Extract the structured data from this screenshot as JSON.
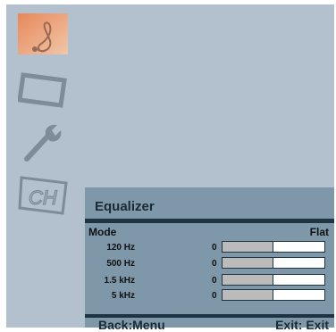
{
  "sidebar": {
    "items": [
      {
        "name": "audio",
        "icon": "music-note-icon",
        "selected": true
      },
      {
        "name": "picture",
        "icon": "tv-screen-icon",
        "selected": false
      },
      {
        "name": "setup",
        "icon": "wrench-icon",
        "selected": false
      },
      {
        "name": "channel",
        "icon": "channel-icon",
        "label": "CH",
        "selected": false
      }
    ]
  },
  "equalizer": {
    "title": "Equalizer",
    "mode_label": "Mode",
    "mode_value": "Flat",
    "bands": [
      {
        "label": "120 Hz",
        "value": "0",
        "level": 0.5
      },
      {
        "label": "500 Hz",
        "value": "0",
        "level": 0.5
      },
      {
        "label": "1.5 kHz",
        "value": "0",
        "level": 0.5
      },
      {
        "label": "5 kHz",
        "value": "0",
        "level": 0.5
      }
    ]
  },
  "footer": {
    "back": "Back:Menu",
    "exit": "Exit: Exit"
  },
  "colors": {
    "background": "#b2c1cd",
    "panel": "#7e98aa",
    "selected": "#e0a07a",
    "dark": "#1f3442"
  }
}
